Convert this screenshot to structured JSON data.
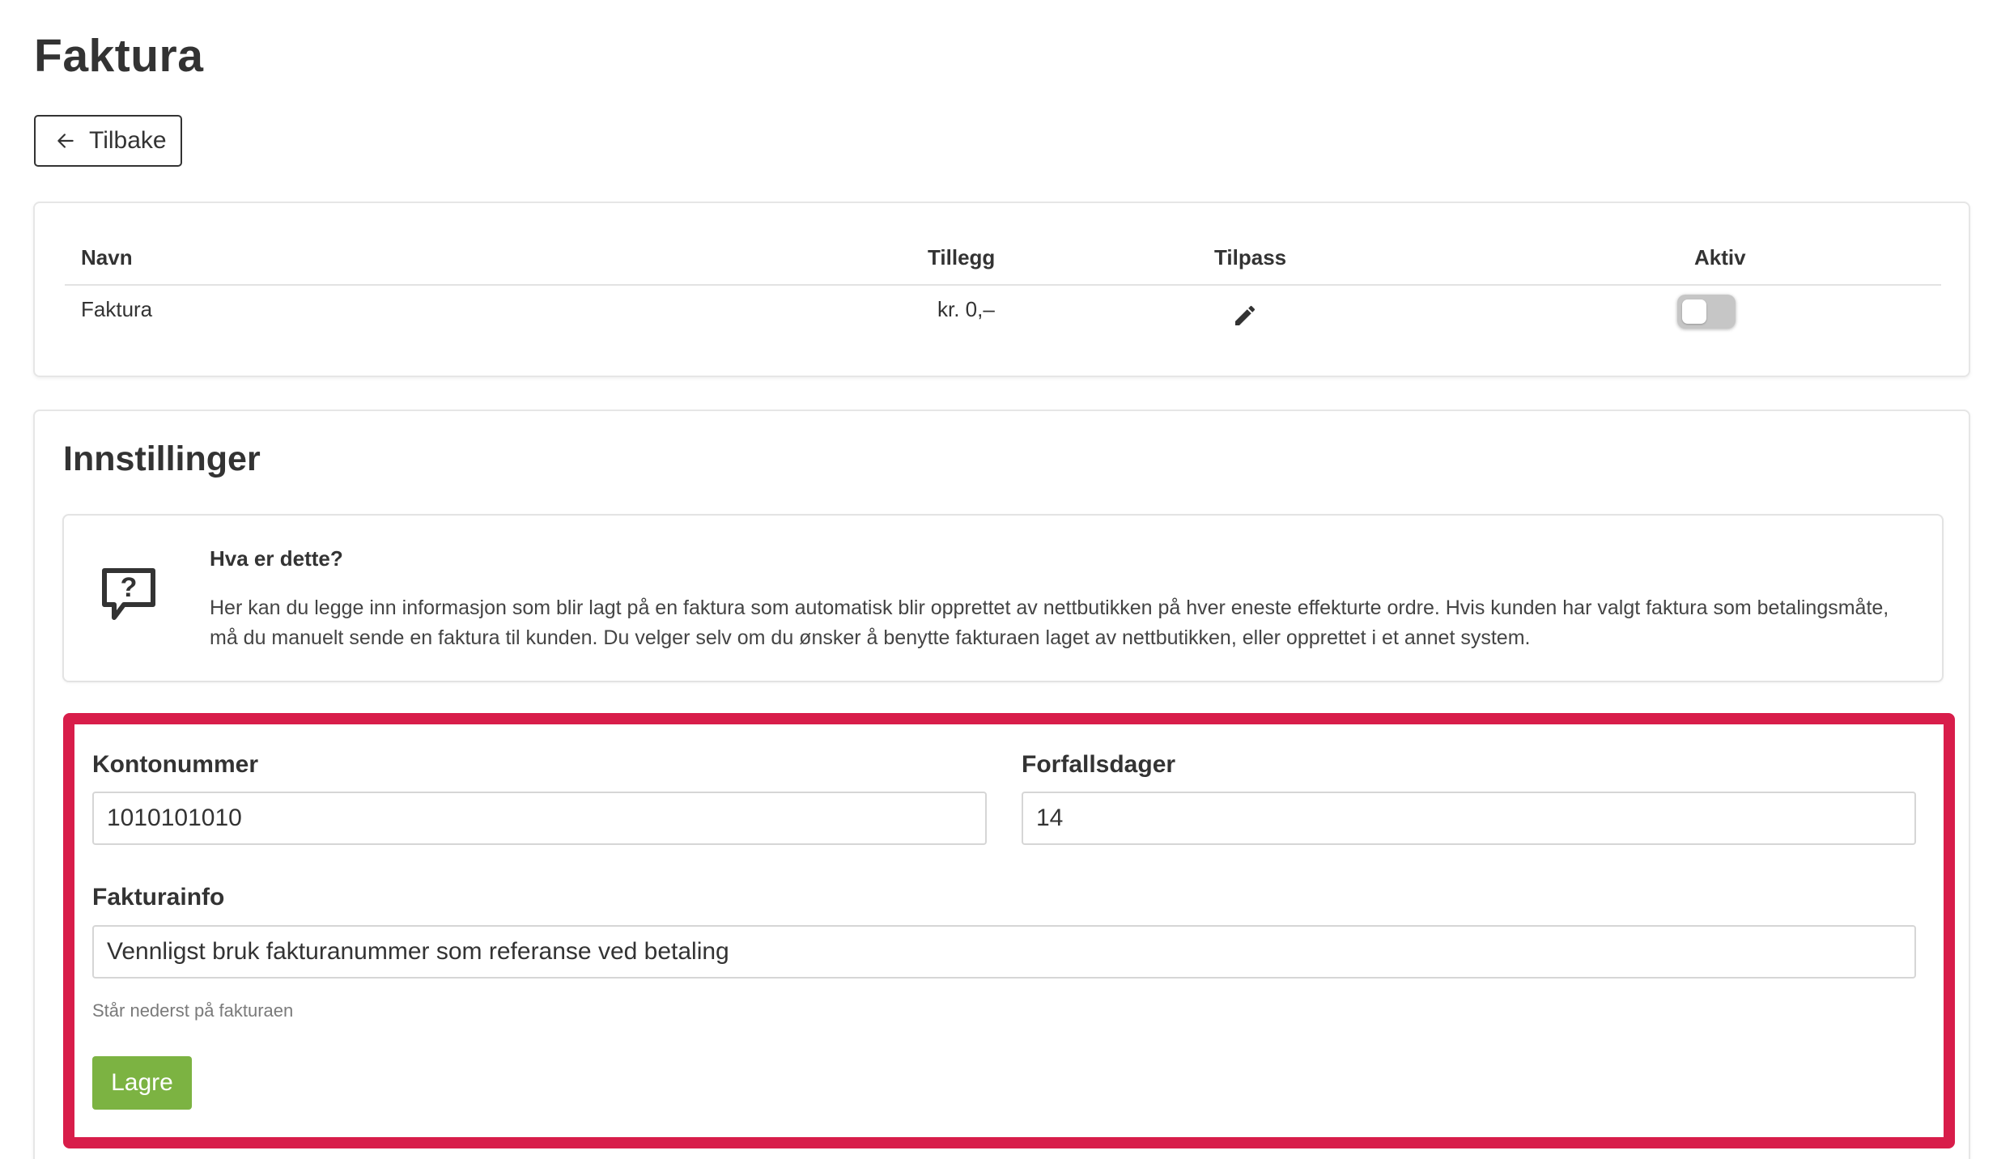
{
  "page": {
    "title": "Faktura"
  },
  "back_button": {
    "label": "Tilbake",
    "icon": "arrow-left-icon"
  },
  "payment_methods_table": {
    "columns": {
      "name": "Navn",
      "fee": "Tillegg",
      "customize": "Tilpass",
      "active": "Aktiv"
    },
    "rows": [
      {
        "name": "Faktura",
        "fee": "kr. 0,–",
        "customize_icon": "pencil-icon",
        "active": false
      }
    ]
  },
  "settings": {
    "title": "Innstillinger",
    "info": {
      "icon": "question-bubble-icon",
      "heading": "Hva er dette?",
      "text": "Her kan du legge inn informasjon som blir lagt på en faktura som automatisk blir opprettet av nettbutikken på hver eneste effekturte ordre. Hvis kunden har valgt faktura som betalingsmåte, må du manuelt sende en faktura til kunden. Du velger selv om du ønsker å benytte fakturaen laget av nettbutikken, eller opprettet i et annet system."
    },
    "form": {
      "account_number": {
        "label": "Kontonummer",
        "value": "1010101010"
      },
      "due_days": {
        "label": "Forfallsdager",
        "value": "14"
      },
      "invoice_info": {
        "label": "Fakturainfo",
        "value": "Vennligst bruk fakturanummer som referanse ved betaling",
        "helper": "Står nederst på fakturaen"
      },
      "save_label": "Lagre"
    }
  },
  "colors": {
    "highlight_border": "#d81d4a",
    "save_button": "#7cb342",
    "text": "#333333"
  }
}
